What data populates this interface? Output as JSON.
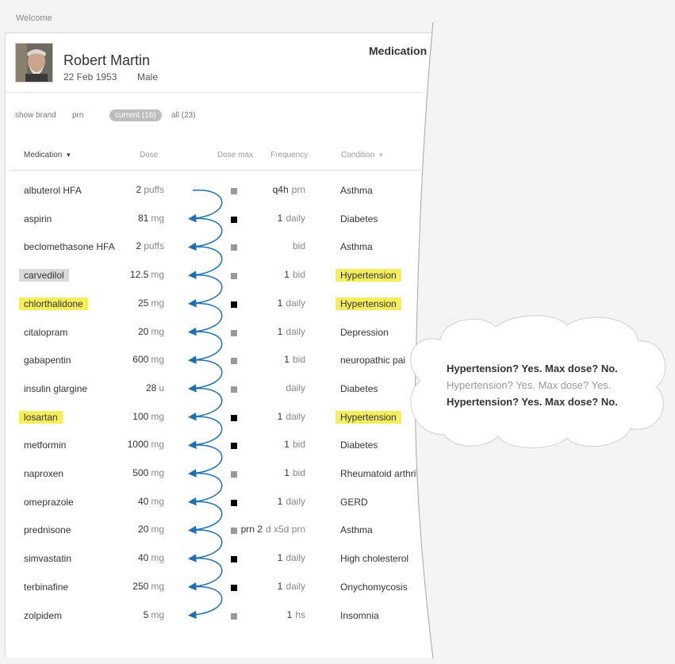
{
  "welcome": "Welcome",
  "patient": {
    "name": "Robert Martin",
    "dob": "22 Feb 1953",
    "gender": "Male"
  },
  "panel_title": "Medication",
  "filters": {
    "show_brand": "show brand",
    "prn": "prn",
    "current": "current (16)",
    "all": "all (23)"
  },
  "columns": {
    "medication": "Medication",
    "dose": "Dose",
    "dose_max": "Dose max",
    "frequency": "Frequency",
    "condition": "Condition"
  },
  "colors": {
    "highlight": "#f5ee5a",
    "arrow": "#1f6fb2",
    "selected": "#d9d9d9"
  },
  "medications": [
    {
      "name": "albuterol HFA",
      "dose": "2",
      "unit": "puffs",
      "max": "gray",
      "freq_num": "q4h",
      "freq": "prn",
      "condition": "Asthma",
      "hl": ""
    },
    {
      "name": "aspirin",
      "dose": "81",
      "unit": "mg",
      "max": "black",
      "freq_num": "1",
      "freq": "daily",
      "condition": "Diabetes",
      "hl": ""
    },
    {
      "name": "beclomethasone HFA",
      "dose": "2",
      "unit": "puffs",
      "max": "gray",
      "freq_num": "",
      "freq": "bid",
      "condition": "Asthma",
      "hl": ""
    },
    {
      "name": "carvedilol",
      "dose": "12.5",
      "unit": "mg",
      "max": "gray",
      "freq_num": "1",
      "freq": "bid",
      "condition": "Hypertension",
      "hl": "sel"
    },
    {
      "name": "chlorthalidone",
      "dose": "25",
      "unit": "mg",
      "max": "black",
      "freq_num": "1",
      "freq": "daily",
      "condition": "Hypertension",
      "hl": "hl"
    },
    {
      "name": "citalopram",
      "dose": "20",
      "unit": "mg",
      "max": "gray",
      "freq_num": "1",
      "freq": "daily",
      "condition": "Depression",
      "hl": ""
    },
    {
      "name": "gabapentin",
      "dose": "600",
      "unit": "mg",
      "max": "gray",
      "freq_num": "1",
      "freq": "bid",
      "condition": "neuropathic pai",
      "hl": ""
    },
    {
      "name": "insulin glargine",
      "dose": "28",
      "unit": "u",
      "max": "gray",
      "freq_num": "",
      "freq": "daily",
      "condition": "Diabetes",
      "hl": ""
    },
    {
      "name": "losartan",
      "dose": "100",
      "unit": "mg",
      "max": "black",
      "freq_num": "1",
      "freq": "daily",
      "condition": "Hypertension",
      "hl": "hl"
    },
    {
      "name": "metformin",
      "dose": "1000",
      "unit": "mg",
      "max": "black",
      "freq_num": "1",
      "freq": "bid",
      "condition": "Diabetes",
      "hl": ""
    },
    {
      "name": "naproxen",
      "dose": "500",
      "unit": "mg",
      "max": "gray",
      "freq_num": "1",
      "freq": "bid",
      "condition": "Rheumatoid arthritis",
      "hl": ""
    },
    {
      "name": "omeprazole",
      "dose": "40",
      "unit": "mg",
      "max": "black",
      "freq_num": "1",
      "freq": "daily",
      "condition": "GERD",
      "hl": ""
    },
    {
      "name": "prednisone",
      "dose": "20",
      "unit": "mg",
      "max": "gray",
      "freq_num": "prn 2",
      "freq": "d x5d prn",
      "condition": "Asthma",
      "hl": ""
    },
    {
      "name": "simvastatin",
      "dose": "40",
      "unit": "mg",
      "max": "black",
      "freq_num": "1",
      "freq": "daily",
      "condition": "High cholesterol",
      "hl": ""
    },
    {
      "name": "terbinafine",
      "dose": "250",
      "unit": "mg",
      "max": "black",
      "freq_num": "1",
      "freq": "daily",
      "condition": "Onychomycosis",
      "hl": ""
    },
    {
      "name": "zolpidem",
      "dose": "5",
      "unit": "mg",
      "max": "gray",
      "freq_num": "1",
      "freq": "hs",
      "condition": "Insomnia",
      "hl": ""
    }
  ],
  "cloud": {
    "line1": "Hypertension? Yes. Max dose? No.",
    "line2": "Hypertension? Yes. Max dose? Yes.",
    "line3": "Hypertension? Yes. Max dose? No."
  }
}
